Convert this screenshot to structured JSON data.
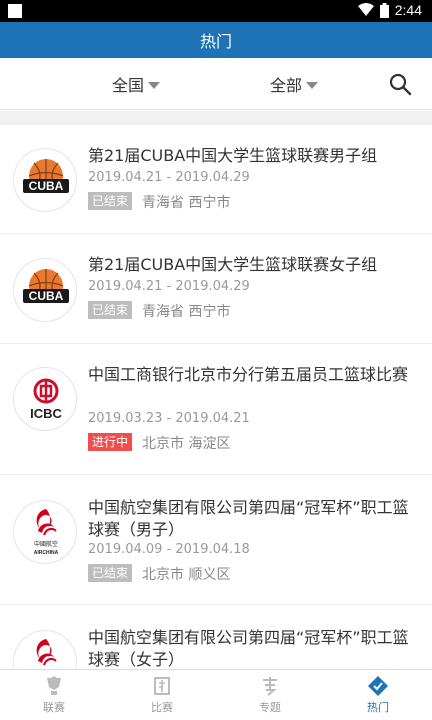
{
  "status": {
    "time": "2:44"
  },
  "header": {
    "title": "热门"
  },
  "filters": {
    "region": "全国",
    "category": "全部"
  },
  "events": [
    {
      "title": "第21届CUBA中国大学生篮球联赛男子组",
      "dates": "2019.04.21 - 2019.04.29",
      "status": "已结束",
      "location": "青海省 西宁市",
      "logo": "cuba"
    },
    {
      "title": "第21届CUBA中国大学生篮球联赛女子组",
      "dates": "2019.04.21 - 2019.04.29",
      "status": "已结束",
      "location": "青海省 西宁市",
      "logo": "cuba"
    },
    {
      "title": "中国工商银行北京市分行第五届员工篮球比赛",
      "dates": "2019.03.23 - 2019.04.21",
      "status": "进行中",
      "location": "北京市 海淀区",
      "logo": "icbc"
    },
    {
      "title": "中国航空集团有限公司第四届“冠军杯”职工篮球赛（男子）",
      "dates": "2019.04.09 - 2019.04.18",
      "status": "已结束",
      "location": "北京市 顺义区",
      "logo": "airchina"
    },
    {
      "title": "中国航空集团有限公司第四届“冠军杯”职工篮球赛（女子）",
      "logo": "airchina"
    }
  ],
  "logos": {
    "cuba_text": "CUBA",
    "icbc_text": "ICBC",
    "airchina_text": "AIRCHINA",
    "airchina_cn": "中國航空"
  },
  "tabs": [
    {
      "label": "联赛",
      "icon": "trophy-icon"
    },
    {
      "label": "比赛",
      "icon": "match-icon"
    },
    {
      "label": "专题",
      "icon": "topic-icon"
    },
    {
      "label": "热门",
      "icon": "hot-icon",
      "active": true
    }
  ],
  "colors": {
    "primary": "#1e73b6",
    "live": "#ef4e4e",
    "ended": "#bdbdbd",
    "cuba_orange": "#e67a2e",
    "icbc_red": "#c8102e"
  }
}
